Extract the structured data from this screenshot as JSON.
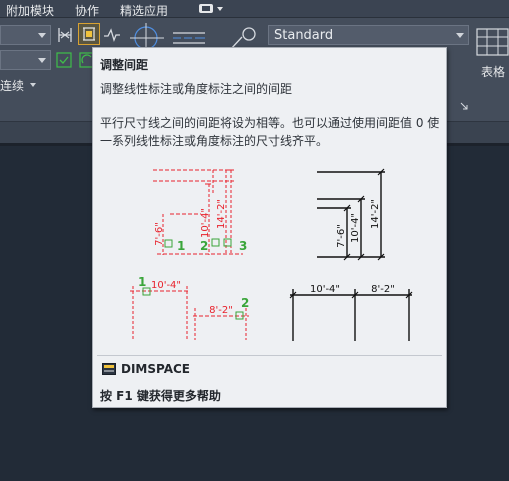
{
  "menubar": {
    "items": [
      {
        "id": "addins",
        "label": "附加模块"
      },
      {
        "id": "collab",
        "label": "协作"
      },
      {
        "id": "featured",
        "label": "精选应用"
      }
    ]
  },
  "ribbon": {
    "dimstyle_value": "Standard",
    "continue_label": "连续",
    "table_label": "表格"
  },
  "tooltip": {
    "title": "调整间距",
    "summary": "调整线性标注或角度标注之间的间距",
    "description": "平行尺寸线之间的间距将设为相等。也可以通过使用间距值 0 使一系列线性标注或角度标注的尺寸线齐平。",
    "command": "DIMSPACE",
    "help": "按 F1 键获得更多帮助",
    "illustration": {
      "before_vertical": {
        "labels": [
          "7'-6\"",
          "10'-4\"",
          "14'-2\""
        ],
        "picks": [
          "1",
          "2",
          "3"
        ]
      },
      "after_vertical": {
        "labels": [
          "7'-6\"",
          "10'-4\"",
          "14'-2\""
        ]
      },
      "before_horizontal": {
        "labels": [
          "10'-4\"",
          "8'-2\""
        ],
        "picks": [
          "1",
          "2"
        ]
      },
      "after_horizontal": {
        "labels": [
          "10'-4\"",
          "8'-2\""
        ]
      },
      "colors": {
        "before": "#e8222c",
        "after": "#111111",
        "pick": "#3aa53a"
      }
    }
  }
}
